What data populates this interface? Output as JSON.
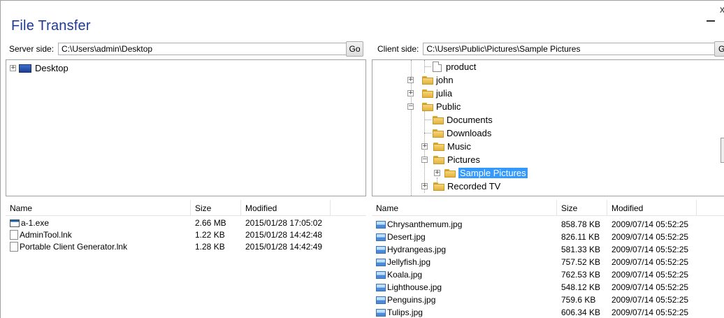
{
  "window": {
    "title": "File Transfer",
    "minimize_glyph": "—",
    "close_glyph": "x"
  },
  "server": {
    "label": "Server side:",
    "path": "C:\\Users\\admin\\Desktop",
    "go_label": "Go",
    "tree": {
      "root_label": "Desktop",
      "root_expand": "+"
    },
    "columns": [
      "Name",
      "Size",
      "Modified"
    ],
    "files": [
      {
        "name": "a-1.exe",
        "size": "2.66 MB",
        "modified": "2015/01/28 17:05:02",
        "icon": "exe-icon"
      },
      {
        "name": "AdminTool.lnk",
        "size": "1.22 KB",
        "modified": "2015/01/28 14:42:48",
        "icon": "shortcut-icon"
      },
      {
        "name": "Portable Client Generator.lnk",
        "size": "1.28 KB",
        "modified": "2015/01/28 14:42:49",
        "icon": "shortcut-icon"
      }
    ]
  },
  "client": {
    "label": "Client side:",
    "path": "C:\\Users\\Public\\Pictures\\Sample Pictures",
    "go_label": "Go",
    "tree": {
      "product": "product",
      "john": "john",
      "julia": "julia",
      "public": "Public",
      "documents": "Documents",
      "downloads": "Downloads",
      "music": "Music",
      "pictures": "Pictures",
      "sample_pictures": "Sample Pictures",
      "recorded_tv": "Recorded TV",
      "expand": "+",
      "collapse": "−"
    },
    "columns": [
      "Name",
      "Size",
      "Modified"
    ],
    "files": [
      {
        "name": "Chrysanthemum.jpg",
        "size": "858.78 KB",
        "modified": "2009/07/14 05:52:25",
        "icon": "image-icon"
      },
      {
        "name": "Desert.jpg",
        "size": "826.11 KB",
        "modified": "2009/07/14 05:52:25",
        "icon": "image-icon"
      },
      {
        "name": "Hydrangeas.jpg",
        "size": "581.33 KB",
        "modified": "2009/07/14 05:52:25",
        "icon": "image-icon"
      },
      {
        "name": "Jellyfish.jpg",
        "size": "757.52 KB",
        "modified": "2009/07/14 05:52:25",
        "icon": "image-icon"
      },
      {
        "name": "Koala.jpg",
        "size": "762.53 KB",
        "modified": "2009/07/14 05:52:25",
        "icon": "image-icon"
      },
      {
        "name": "Lighthouse.jpg",
        "size": "548.12 KB",
        "modified": "2009/07/14 05:52:25",
        "icon": "image-icon"
      },
      {
        "name": "Penguins.jpg",
        "size": "759.6 KB",
        "modified": "2009/07/14 05:52:25",
        "icon": "image-icon"
      },
      {
        "name": "Tulips.jpg",
        "size": "606.34 KB",
        "modified": "2009/07/14 05:52:25",
        "icon": "image-icon"
      }
    ]
  },
  "colors": {
    "title": "#1f3a93",
    "selection": "#3399ff",
    "folder": "#f6d57a"
  }
}
